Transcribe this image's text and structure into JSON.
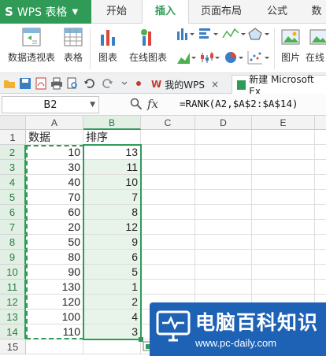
{
  "app": {
    "logo_letter": "S",
    "name": "WPS 表格"
  },
  "tabs": [
    "开始",
    "插入",
    "页面布局",
    "公式",
    "数"
  ],
  "active_tab": "插入",
  "ribbon": {
    "pivot_table": "数据透视表",
    "table": "表格",
    "chart": "图表",
    "online_chart": "在线图表",
    "picture": "图片",
    "online": "在线"
  },
  "doc_tabs": {
    "home": "我的WPS",
    "current": "新建 Microsoft Ex"
  },
  "formula_bar": {
    "cell_ref": "B2",
    "fx": "fx",
    "formula": "=RANK(A2,$A$2:$A$14)"
  },
  "sheet": {
    "columns": [
      "A",
      "B",
      "C",
      "D",
      "E"
    ],
    "rows": [
      "1",
      "2",
      "3",
      "4",
      "5",
      "6",
      "7",
      "8",
      "9",
      "10",
      "11",
      "12",
      "13",
      "14",
      "15"
    ],
    "header": {
      "a": "数据",
      "b": "排序"
    },
    "data": [
      {
        "a": "10",
        "b": "13"
      },
      {
        "a": "30",
        "b": "11"
      },
      {
        "a": "40",
        "b": "10"
      },
      {
        "a": "70",
        "b": "7"
      },
      {
        "a": "60",
        "b": "8"
      },
      {
        "a": "20",
        "b": "12"
      },
      {
        "a": "50",
        "b": "9"
      },
      {
        "a": "80",
        "b": "6"
      },
      {
        "a": "90",
        "b": "5"
      },
      {
        "a": "130",
        "b": "1"
      },
      {
        "a": "120",
        "b": "2"
      },
      {
        "a": "100",
        "b": "4"
      },
      {
        "a": "110",
        "b": "3"
      }
    ]
  },
  "watermark": {
    "title": "电脑百科知识",
    "url": "www.pc-daily.com"
  },
  "colors": {
    "accent": "#2f9b57",
    "watermark_bg": "#1d62b5"
  }
}
